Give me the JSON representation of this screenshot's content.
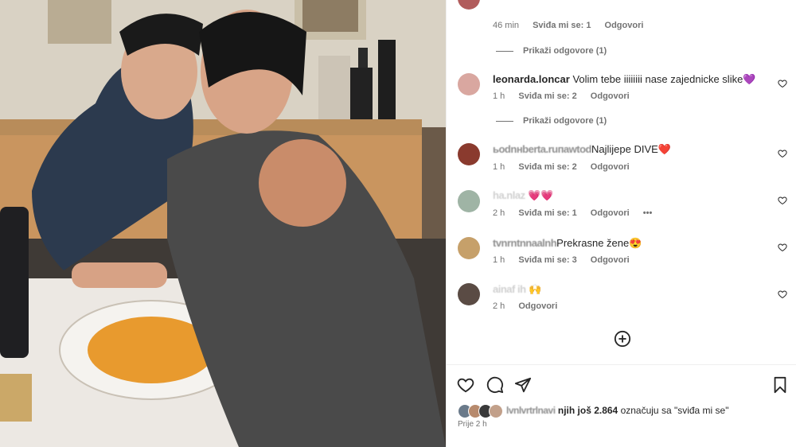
{
  "comments": [
    {
      "meta": [
        "46 min",
        "Sviđa mi se: 1",
        "Odgovori"
      ]
    },
    {
      "username": "leonarda.loncar",
      "text": "Volim tebe iiiiiiii nase zajednicke slike💜",
      "meta": [
        "1 h",
        "Sviđa mi se: 2",
        "Odgovori"
      ],
      "replies": "Prikaži odgovore (1)"
    },
    {
      "username": "ьоdnнbеrtа.ruпаwtоd",
      "text": "Najlijepe DIVE❤️",
      "meta": [
        "1 h",
        "Sviđa mi se: 2",
        "Odgovori"
      ]
    },
    {
      "username": "ha.nlaz",
      "text": "💗💗",
      "meta": [
        "2 h",
        "Sviđa mi se: 1",
        "Odgovori"
      ],
      "more": "•••"
    },
    {
      "username": "tvnrntnnaalnh",
      "text": "Prekrasne žene😍",
      "meta": [
        "1 h",
        "Sviđa mi se: 3",
        "Odgovori"
      ]
    },
    {
      "username": "ainaf ih",
      "text": "🙌",
      "meta": [
        "2 h",
        "Odgovori"
      ]
    }
  ],
  "top_replies": "Prikaži odgovore (1)",
  "likes": {
    "prefix": "lvnlvrtrlnavi",
    "text": " njih još ",
    "count": "2.864",
    "suffix": " označuju sa \"sviđa mi se\""
  },
  "posted": "Prije 2 h",
  "icons": {
    "like": "heart-icon",
    "comment": "comment-icon",
    "share": "send-icon",
    "save": "bookmark-icon",
    "add": "plus-circle-icon"
  }
}
